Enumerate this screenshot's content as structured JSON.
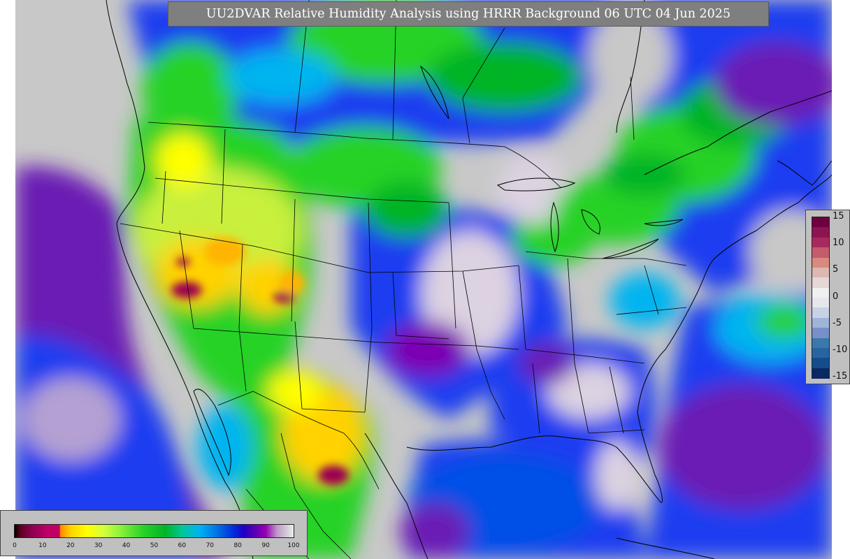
{
  "title": "UU2DVAR Relative Humidity Analysis using HRRR Background 06 UTC 04 Jun 2025",
  "colors": {
    "land_no_data": "#c8c8c8",
    "dry": "#ffd200",
    "very_dry": "#9b0050",
    "moderate": "#28d228",
    "moist": "#1e3cf0",
    "very_moist": "#7b00b4",
    "saturated": "#dcd2e1",
    "borders": "#000000"
  },
  "increment_legend": {
    "tick_labels": [
      "15",
      "10",
      "5",
      "0",
      "-5",
      "-10",
      "-15"
    ],
    "segments": [
      "#6e0040",
      "#8c1450",
      "#a82a5c",
      "#c45c6c",
      "#d88a7c",
      "#dcb8b0",
      "#e6d6d6",
      "#f0f0f0",
      "#e6e6ec",
      "#c8d2e6",
      "#a0b4d8",
      "#7890c8",
      "#3c78aa",
      "#2864a0",
      "#144c8c",
      "#0a2864"
    ]
  },
  "rh_legend": {
    "tick_labels": [
      "0",
      "10",
      "20",
      "30",
      "40",
      "50",
      "60",
      "70",
      "80",
      "90",
      "100"
    ],
    "tick_values": [
      0,
      10,
      20,
      30,
      40,
      50,
      60,
      70,
      80,
      90,
      100
    ]
  }
}
